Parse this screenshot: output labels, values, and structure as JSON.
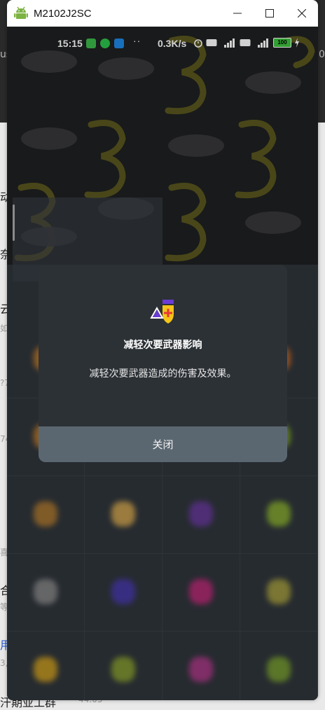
{
  "window": {
    "title": "M2102J2SC"
  },
  "statusbar": {
    "time": "15:15",
    "dots": "··",
    "net_speed": "0.3K/s",
    "battery": "100"
  },
  "dialog": {
    "title": "减轻次要武器影响",
    "description": "减轻次要武器造成的伤害及效果。",
    "close_label": "关闭"
  },
  "background_fragments": [
    "us",
    "0",
    "动",
    "奈",
    "云",
    "如",
    "?7",
    "74",
    "喜",
    "合",
    "等",
    "用",
    "3,",
    "汗期亚工群",
    "44.05"
  ]
}
